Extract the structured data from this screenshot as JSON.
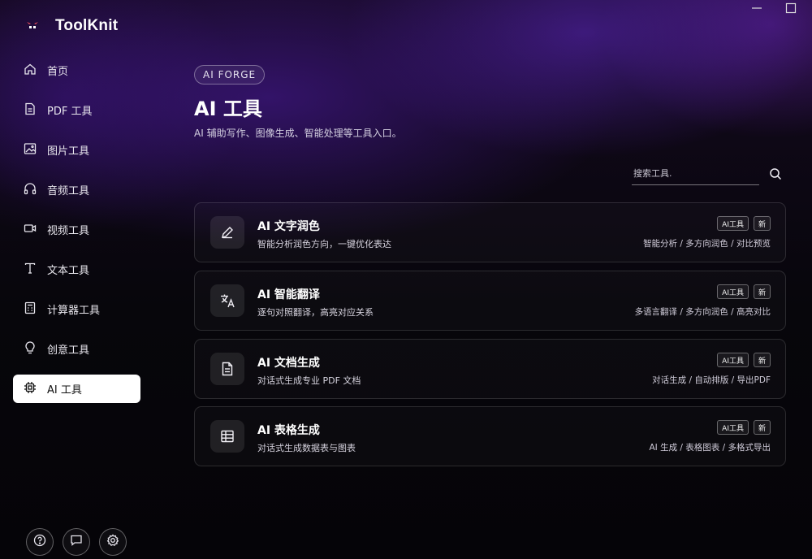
{
  "app": {
    "title": "ToolKnit"
  },
  "window_controls": [
    "minimize-icon",
    "maximize-icon"
  ],
  "sidebar": {
    "items": [
      {
        "label": "首页",
        "icon": "home-icon"
      },
      {
        "label": "PDF 工具",
        "icon": "document-icon"
      },
      {
        "label": "图片工具",
        "icon": "image-icon"
      },
      {
        "label": "音频工具",
        "icon": "headphones-icon"
      },
      {
        "label": "视频工具",
        "icon": "video-camera-icon"
      },
      {
        "label": "文本工具",
        "icon": "text-icon"
      },
      {
        "label": "计算器工具",
        "icon": "calculator-icon"
      },
      {
        "label": "创意工具",
        "icon": "lightbulb-icon"
      },
      {
        "label": "AI 工具",
        "icon": "chip-icon",
        "active": true
      }
    ],
    "bottom_buttons": [
      "help-icon",
      "chat-icon",
      "settings-icon"
    ]
  },
  "main": {
    "badge": "AI FORGE",
    "title": "AI 工具",
    "subtitle": "AI 辅助写作、图像生成、智能处理等工具入口。",
    "search": {
      "placeholder": "搜索工具."
    },
    "cards": [
      {
        "title": "AI 文字润色",
        "desc": "智能分析润色方向，一键优化表达",
        "tags": [
          "AI工具",
          "新"
        ],
        "features": "智能分析 / 多方向润色 / 对比预览",
        "icon": "pencil-icon"
      },
      {
        "title": "AI 智能翻译",
        "desc": "逐句对照翻译，高亮对应关系",
        "tags": [
          "AI工具",
          "新"
        ],
        "features": "多语言翻译 / 多方向润色 / 高亮对比",
        "icon": "translate-icon"
      },
      {
        "title": "AI 文档生成",
        "desc": "对话式生成专业 PDF 文档",
        "tags": [
          "AI工具",
          "新"
        ],
        "features": "对话生成 / 自动排版 / 导出PDF",
        "icon": "document-text-icon"
      },
      {
        "title": "AI 表格生成",
        "desc": "对话式生成数据表与图表",
        "tags": [
          "AI工具",
          "新"
        ],
        "features": "AI 生成 / 表格图表 / 多格式导出",
        "icon": "table-icon"
      }
    ]
  },
  "colors": {
    "accent": "#5b22c2",
    "background": "#07060b",
    "active_nav_bg": "#ffffff"
  }
}
